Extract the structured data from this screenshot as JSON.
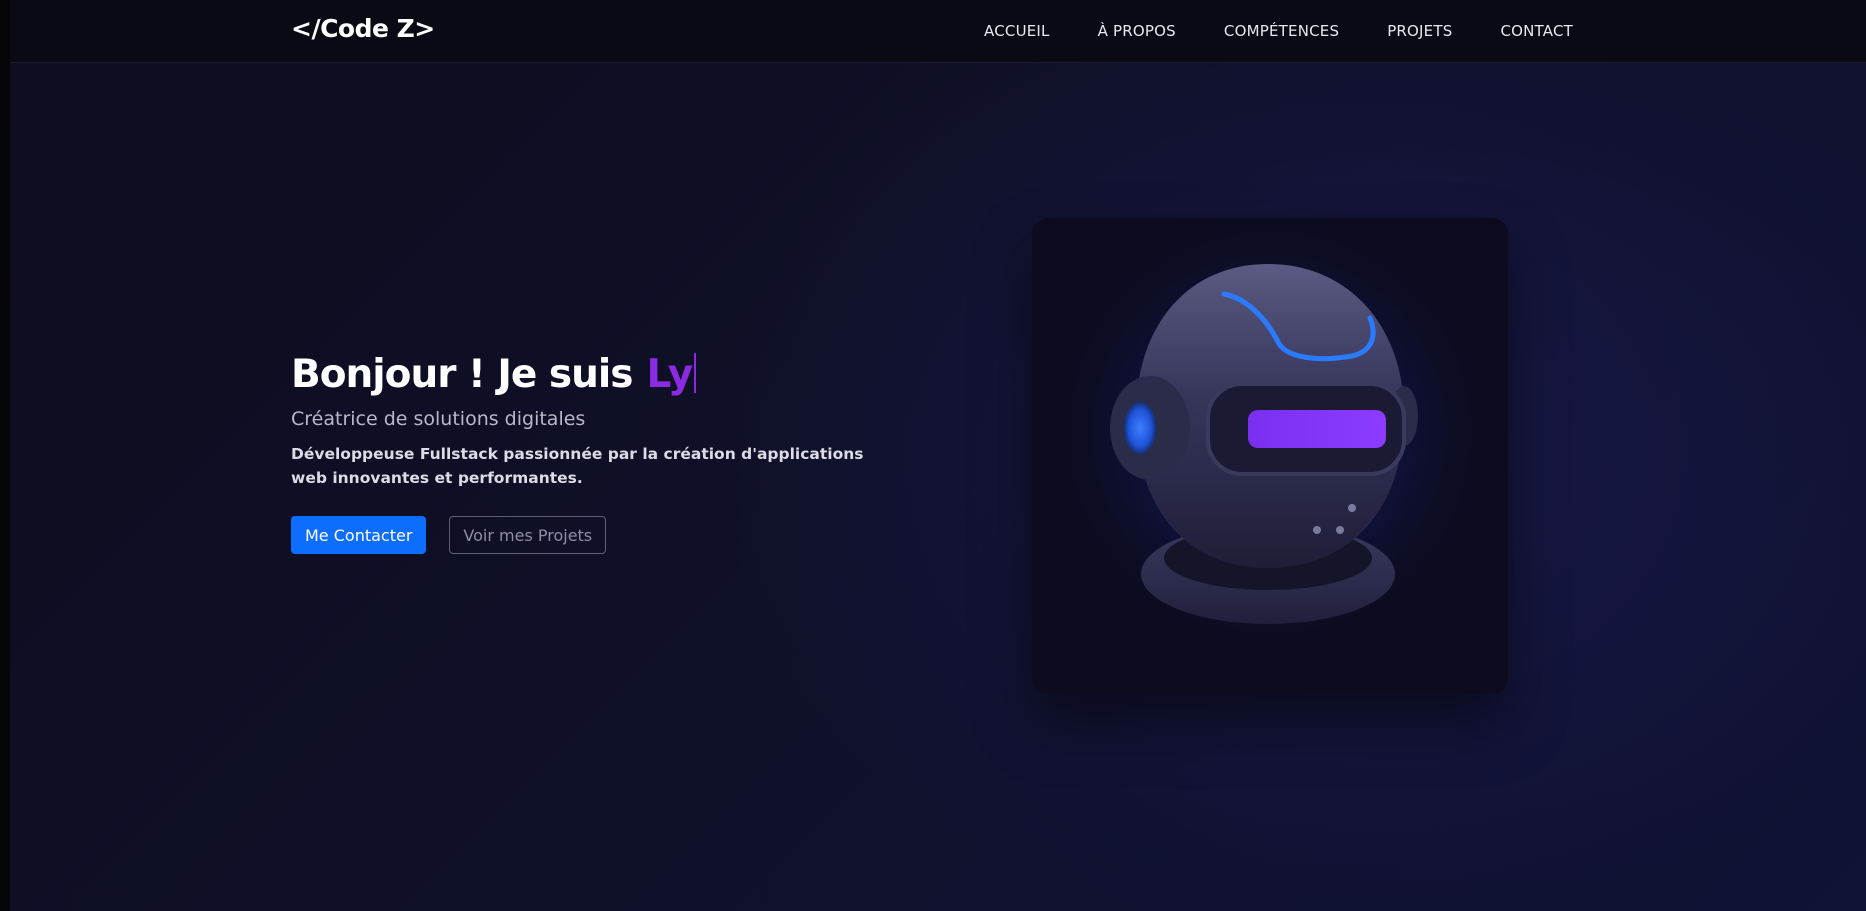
{
  "navbar": {
    "logo": "</Code Z>",
    "links": [
      {
        "label": "ACCUEIL"
      },
      {
        "label": "À PROPOS"
      },
      {
        "label": "COMPÉTENCES"
      },
      {
        "label": "PROJETS"
      },
      {
        "label": "CONTACT"
      }
    ]
  },
  "hero": {
    "greeting": "Bonjour ! Je suis",
    "typed_name": "Ly",
    "subtitle": "Créatrice de solutions digitales",
    "description": "Développeuse Fullstack passionnée par la création d'applications web innovantes et performantes.",
    "primary_button": "Me Contacter",
    "secondary_button": "Voir mes Projets"
  },
  "colors": {
    "accent_purple": "#8a2be2",
    "button_blue": "#0d6efd",
    "background": "#0f1028",
    "visor_purple": "#7a2ff0",
    "glow_blue": "#1f6bff"
  },
  "illustration": {
    "icon": "robot-helmet-icon"
  }
}
